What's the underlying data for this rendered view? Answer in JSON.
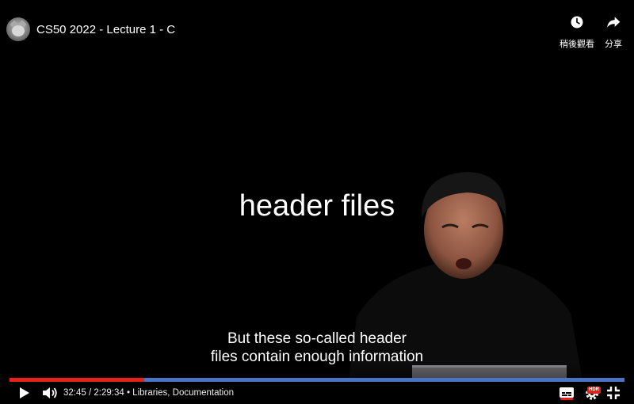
{
  "header": {
    "title": "CS50 2022 - Lecture 1 - C",
    "avatar_icon": "cat-avatar-icon",
    "actions": [
      {
        "label": "稍後觀看",
        "icon": "clock-icon"
      },
      {
        "label": "分享",
        "icon": "share-arrow-icon"
      }
    ]
  },
  "video": {
    "slide_text": "header files",
    "captions": [
      "But these so-called header",
      "files contain enough information"
    ]
  },
  "controls": {
    "time_current": "32:45",
    "time_separator": " / ",
    "time_total": "2:29:34",
    "chapter_separator": " • ",
    "chapter": "Libraries, Documentation",
    "progress_played_fraction": 0.219,
    "progress_buffered_fraction": 1.0,
    "hd_badge": "HDR",
    "icons": [
      "play-icon",
      "volume-icon",
      "subtitles-icon",
      "settings-gear-icon",
      "exit-fullscreen-icon"
    ]
  },
  "colors": {
    "progress_played": "#e62117",
    "progress_buffered": "#4a74c8",
    "background": "#000000"
  }
}
